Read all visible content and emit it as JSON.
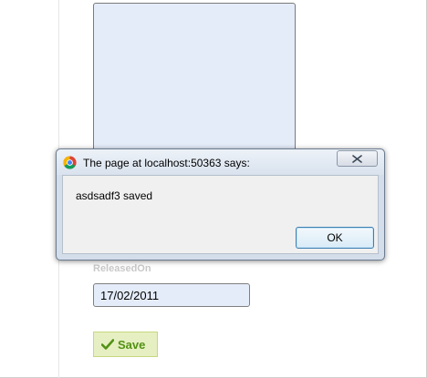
{
  "form": {
    "released_on_label": "ReleasedOn",
    "released_on_value": "17/02/2011",
    "save_label": "Save"
  },
  "dialog": {
    "title": "The page at localhost:50363 says:",
    "message": "asdsadf3 saved",
    "ok_label": "OK"
  },
  "icons": {
    "browser": "chrome-icon",
    "close": "close-icon",
    "save": "checkmark-icon"
  },
  "colors": {
    "field_bg": "#e5ecf9",
    "save_bg": "#e6efc2",
    "save_text": "#529214",
    "dialog_bg": "#d4deeb"
  }
}
